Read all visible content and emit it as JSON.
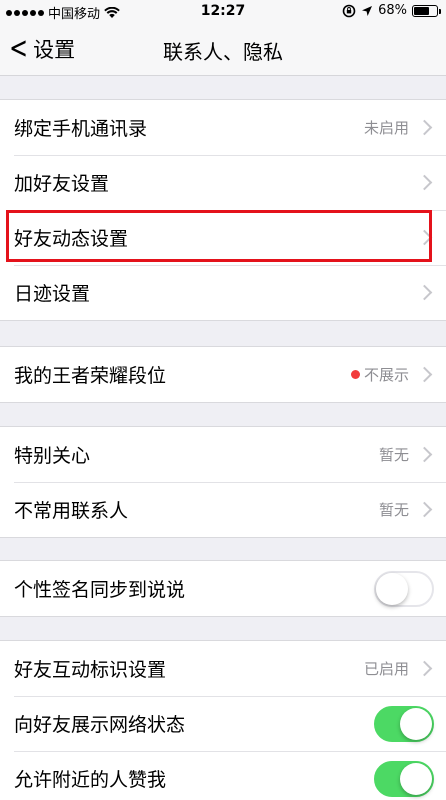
{
  "status_bar": {
    "carrier": "中国移动",
    "time": "12:27",
    "battery_percent": "68%",
    "battery_level": 0.68
  },
  "nav": {
    "back_label": "设置",
    "title": "联系人、隐私"
  },
  "groups": [
    {
      "rows": [
        {
          "label": "绑定手机通讯录",
          "value": "未启用",
          "chevron": true
        },
        {
          "label": "加好友设置",
          "value": "",
          "chevron": true
        },
        {
          "label": "好友动态设置",
          "value": "",
          "chevron": true
        },
        {
          "label": "日迹设置",
          "value": "",
          "chevron": true
        }
      ]
    },
    {
      "rows": [
        {
          "label": "我的王者荣耀段位",
          "value": "不展示",
          "chevron": true,
          "red_dot": true
        }
      ]
    },
    {
      "rows": [
        {
          "label": "特别关心",
          "value": "暂无",
          "chevron": true
        },
        {
          "label": "不常用联系人",
          "value": "暂无",
          "chevron": true
        }
      ]
    },
    {
      "rows": [
        {
          "label": "个性签名同步到说说",
          "toggle": false
        }
      ]
    },
    {
      "rows": [
        {
          "label": "好友互动标识设置",
          "value": "已启用",
          "chevron": true
        },
        {
          "label": "向好友展示网络状态",
          "toggle": true
        },
        {
          "label": "允许附近的人赞我",
          "toggle": true
        }
      ]
    }
  ],
  "colors": {
    "toggle_on": "#4cd964",
    "highlight": "#e4121b",
    "red_dot": "#f23c3c",
    "background": "#efeff4"
  }
}
